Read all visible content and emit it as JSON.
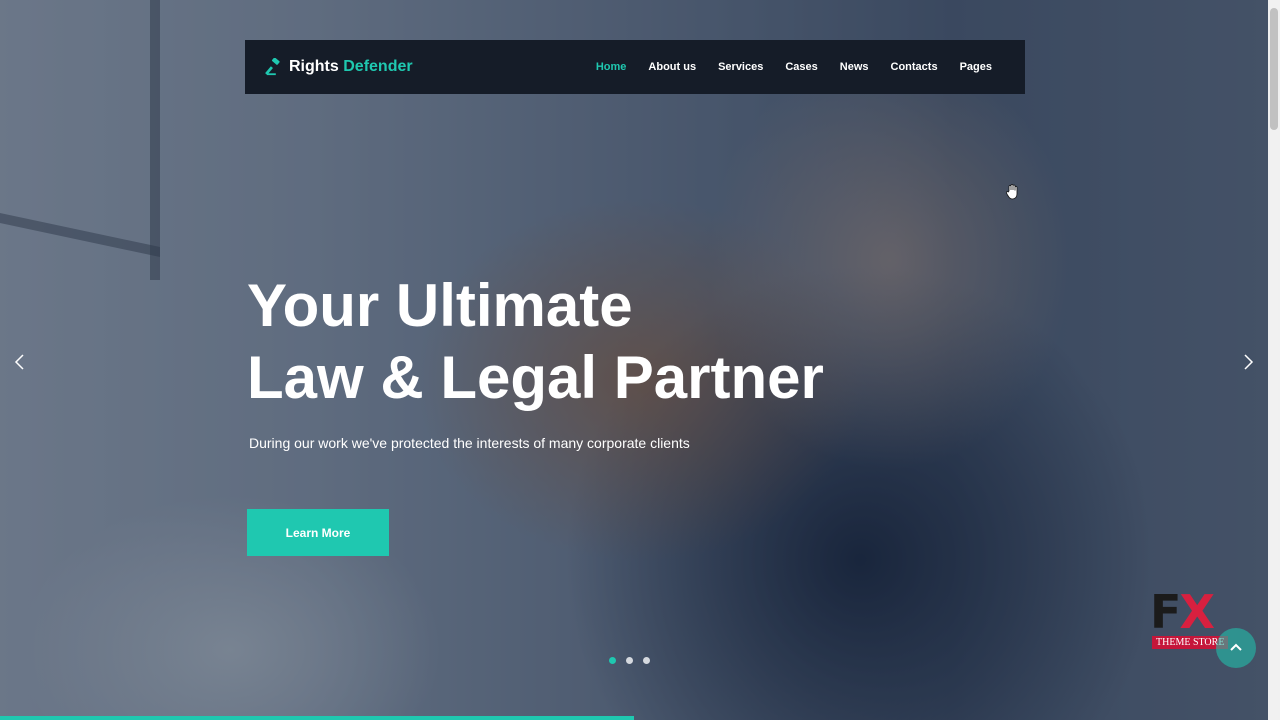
{
  "brand": {
    "name_part1": "Rights",
    "name_part2": "Defender",
    "icon": "gavel-icon"
  },
  "nav": {
    "items": [
      {
        "label": "Home",
        "active": true
      },
      {
        "label": "About us",
        "active": false
      },
      {
        "label": "Services",
        "active": false
      },
      {
        "label": "Cases",
        "active": false
      },
      {
        "label": "News",
        "active": false
      },
      {
        "label": "Contacts",
        "active": false
      },
      {
        "label": "Pages",
        "active": false
      }
    ]
  },
  "hero": {
    "title_line1": "Your Ultimate",
    "title_line2": "Law & Legal Partner",
    "subtitle": "During our work we've protected the interests of many corporate clients",
    "cta_label": "Learn More",
    "slides": {
      "count": 3,
      "active_index": 0
    },
    "progress_fraction": 0.5
  },
  "badge": {
    "letters_f": "F",
    "letters_x": "X",
    "label": "THEME STORE"
  },
  "colors": {
    "accent": "#1fc8b0",
    "navbar_bg": "#151c28",
    "badge_red": "#c5163a",
    "text": "#ffffff"
  }
}
